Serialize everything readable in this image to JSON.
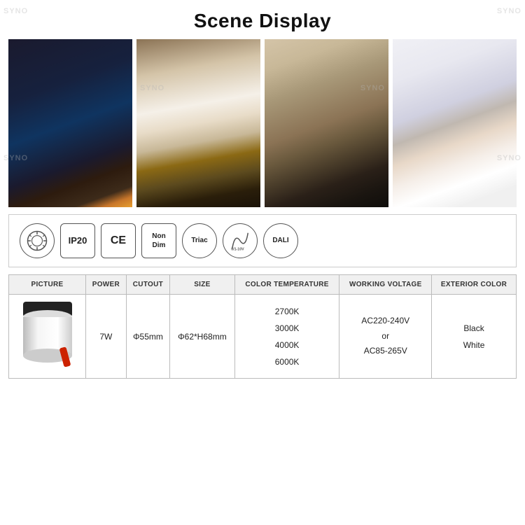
{
  "watermark": "SYNO",
  "title": "Scene Display",
  "scene_images": [
    {
      "id": "scene-1",
      "alt": "Conference room with orange wall lighting"
    },
    {
      "id": "scene-2",
      "alt": "Modern kitchen with pendant lights"
    },
    {
      "id": "scene-3",
      "alt": "Restaurant lounge area"
    },
    {
      "id": "scene-4",
      "alt": "Retail clothing store"
    }
  ],
  "icons": [
    {
      "id": "icon-anti-glare",
      "label": "Anti\nGlare",
      "shape": "circle",
      "symbol": "◎"
    },
    {
      "id": "icon-ip20",
      "label": "IP20",
      "shape": "rect"
    },
    {
      "id": "icon-ce",
      "label": "CE",
      "shape": "rect"
    },
    {
      "id": "icon-nondim",
      "label": "Non\nDim",
      "shape": "rect"
    },
    {
      "id": "icon-triac",
      "label": "Triac",
      "shape": "circle"
    },
    {
      "id": "icon-0-10v",
      "label": "0/1-10V",
      "shape": "circle"
    },
    {
      "id": "icon-dali",
      "label": "DALI",
      "shape": "circle"
    }
  ],
  "table": {
    "headers": [
      "PICTURE",
      "POWER",
      "CUTOUT",
      "SIZE",
      "COLOR TEMPERATURE",
      "WORKING VOLTAGE",
      "EXTERIOR COLOR"
    ],
    "row": {
      "power": "7W",
      "cutout": "Φ55mm",
      "size": "Φ62*H68mm",
      "color_temperatures": [
        "2700K",
        "3000K",
        "4000K",
        "6000K"
      ],
      "voltage_line1": "AC220-240V",
      "voltage_or": "or",
      "voltage_line2": "AC85-265V",
      "exterior_colors": [
        "Black",
        "White"
      ]
    }
  }
}
